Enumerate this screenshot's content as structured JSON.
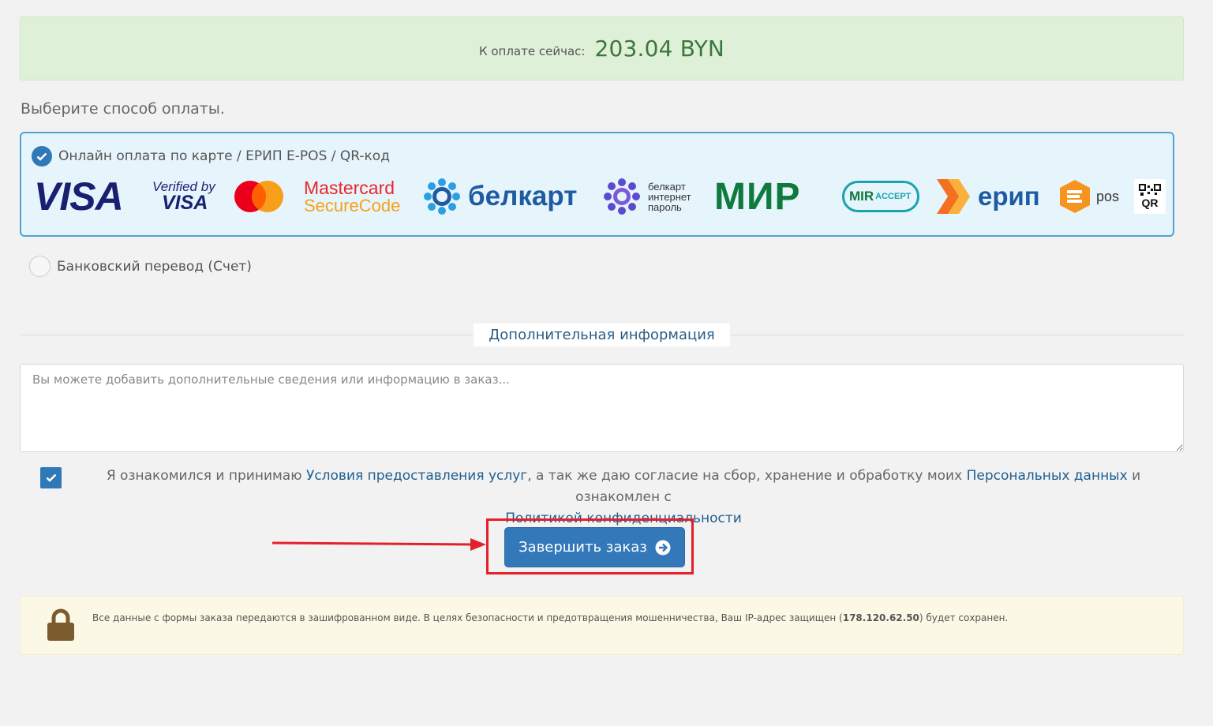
{
  "payment_due": {
    "label": "К оплате сейчас:",
    "amount": "203.04 BYN"
  },
  "choose_method_title": "Выберите способ оплаты.",
  "methods": [
    {
      "label": "Онлайн оплата по карте / ЕРИП E-POS / QR-код",
      "selected": true
    },
    {
      "label": "Банковский перевод (Счет)",
      "selected": false
    }
  ],
  "logos": {
    "visa": "VISA",
    "vbv_top": "Verified by",
    "vbv_bottom": "VISA",
    "mc_top": "Mastercard",
    "mc_bottom": "SecureCode",
    "belkart": "белкарт",
    "belkart_ip": "белкарт\nинтернет\nпароль",
    "mir": "МИР",
    "mir_accept": "ACCEPT",
    "mir_accept_prefix": "MIR",
    "erip": "ерип",
    "epos": "pos",
    "qr": "QR"
  },
  "extra_info": {
    "title": "Дополнительная информация",
    "placeholder": "Вы можете добавить дополнительные сведения или информацию в заказ..."
  },
  "agreement": {
    "checked": true,
    "text1": "Я ознакомился и принимаю",
    "link1": "Условия предоставления услуг",
    "text2": ", а так же даю согласие на сбор, хранение и обработку моих",
    "link2": "Персональных данных",
    "text3": "и ознакомлен с",
    "link3": "Политикой конфиденциальности"
  },
  "submit_label": "Завершить заказ",
  "security_note": {
    "text_before": "Все данные с формы заказа передаются в зашифрованном виде. В целях безопасности и предотвращения мошенничества, Ваш IP-адрес защищен (",
    "ip": "178.120.62.50",
    "text_after": ") будет сохранен."
  },
  "colors": {
    "primary": "#3378b9",
    "success_bg": "#dff0d8",
    "success_text": "#3c763d",
    "highlight": "#e4202a"
  }
}
